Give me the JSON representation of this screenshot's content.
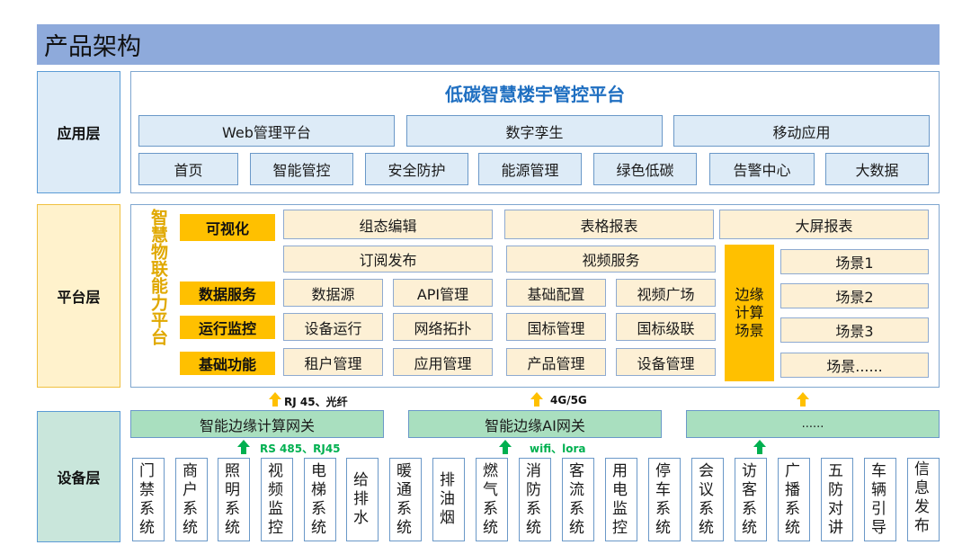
{
  "header": {
    "title": "产品架构"
  },
  "layers": {
    "app": "应用层",
    "platform": "平台层",
    "device": "设备层"
  },
  "app": {
    "title": "低碳智慧楼宇管控平台",
    "row1": [
      "Web管理平台",
      "数字孪生",
      "移动应用"
    ],
    "row2": [
      "首页",
      "智能管控",
      "安全防护",
      "能源管理",
      "绿色低碳",
      "告警中心",
      "大数据"
    ]
  },
  "platform": {
    "vertical_title": "智慧物联能力平台",
    "categories": [
      "可视化",
      "数据服务",
      "运行监控",
      "基础功能"
    ],
    "visual": [
      "组态编辑",
      "表格报表",
      "大屏报表"
    ],
    "visual2": [
      "订阅发布",
      "视频服务"
    ],
    "data_service": [
      "数据源",
      "API管理",
      "基础配置",
      "视频广场"
    ],
    "monitor": [
      "设备运行",
      "网络拓扑",
      "国标管理",
      "国标级联"
    ],
    "basic": [
      "租户管理",
      "应用管理",
      "产品管理",
      "设备管理"
    ],
    "edge": "边缘计算场景",
    "scenes": [
      "场景1",
      "场景2",
      "场景3",
      "场景......"
    ]
  },
  "connectors": {
    "top": [
      "RJ 45、光纤",
      "4G/5G"
    ],
    "bottom": [
      "RS 485、RJ45",
      "wifi、lora"
    ]
  },
  "gateways": [
    "智能边缘计算网关",
    "智能边缘AI网关",
    "......"
  ],
  "devices": [
    "门禁系统",
    "商户系统",
    "照明系统",
    "视频监控",
    "电梯系统",
    "给排水",
    "暖通系统",
    "排油烟",
    "燃气系统",
    "消防系统",
    "客流系统",
    "用电监控",
    "停车系统",
    "会议系统",
    "访客系统",
    "广播系统",
    "五防对讲",
    "车辆引导",
    "信息发布"
  ],
  "colors": {
    "accent_blue": "#1f6fc1",
    "gold": "#ffc000",
    "green": "#00b050",
    "header": "#8eaadb"
  }
}
